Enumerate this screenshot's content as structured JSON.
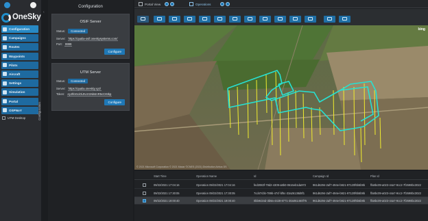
{
  "app": {
    "name": "OneSky"
  },
  "sidebar": {
    "items": [
      {
        "label": "Configuration",
        "icon": "gear-icon",
        "active": true
      },
      {
        "label": "Campaigns",
        "icon": "folder-icon"
      },
      {
        "label": "Routes",
        "icon": "route-icon"
      },
      {
        "label": "Waypoints",
        "icon": "pin-icon"
      },
      {
        "label": "Pilots",
        "icon": "user-icon"
      },
      {
        "label": "Aircraft",
        "icon": "plane-icon"
      },
      {
        "label": "Settings",
        "icon": "sliders-icon"
      },
      {
        "label": "Simulation",
        "icon": "play-icon"
      },
      {
        "label": "Portal",
        "icon": "portal-icon"
      },
      {
        "label": "OSPNoY",
        "icon": "grid-icon"
      }
    ],
    "checkbox_label": "UTM Desktop",
    "vertical_label": "Configuration"
  },
  "config": {
    "title": "Configuration",
    "osif": {
      "title": "OSIF Server",
      "status_label": "Status:",
      "status_value": "Connected",
      "server_label": "Server:",
      "server_value": "https://qualia-osif.oneskysystems.com/",
      "port_label": "Port:",
      "port_value": "9999",
      "button": "Configure"
    },
    "utm": {
      "title": "UTM Server",
      "status_label": "Status:",
      "status_value": "Connected",
      "server_label": "Server:",
      "server_value": "https://qualia.oneskiy.xyz/",
      "token_label": "Token:",
      "token_value": "eyJhbGciOiJIUzI1NiIsInR5cCI6Ikp",
      "button": "Configure"
    }
  },
  "tabs": [
    {
      "label": "Portal View",
      "active": false
    },
    {
      "label": "Operations",
      "active": true
    }
  ],
  "map": {
    "attribution": "© 2021 Microsoft Corporation © 2021 Maxar ©CNES (2021) Distribution Airbus DS",
    "brand": "bing"
  },
  "table": {
    "headers": [
      "Start Time",
      "Operation Name",
      "Id",
      "Campaign Id",
      "Plan Id"
    ],
    "rows": [
      {
        "start": "09/22/2021 17:04:16",
        "name": "Operation 09/22/2021 17:04:16",
        "id": "fed2083f-79d2-4309-a8b0-0616eb1da972",
        "campaign": "961d6294-2af7-494e-b921-97120f6b5b9b",
        "plan": "ffa8bc09-a023-44a7-9cc2-7f2698bc3022",
        "selected": false
      },
      {
        "start": "09/22/2021 17:30:05",
        "name": "Operation 09/22/2021 17:30:05",
        "id": "7cd47cbb-789b-47cf-bf5c-33a26138d8f1",
        "campaign": "961d6294-2af7-494e-b921-97120f6b5b9b",
        "plan": "ffa8bc09-a023-44a7-9cc2-7f2698bc3022",
        "selected": false
      },
      {
        "start": "09/22/2021 19:00:40",
        "name": "Operation 09/22/2021 19:00:40",
        "id": "0bb9434d-3b9a-4428-8771-30a061460f75",
        "campaign": "961d6294-2af7-494e-b921-97120f6b5b9b",
        "plan": "ffa8bc09-a023-44a7-9cc2-7f2698bc3022",
        "selected": true
      }
    ]
  },
  "colors": {
    "accent": "#1e6aa0",
    "route": "#27e1d2",
    "altitude": "#f2ee2e"
  }
}
